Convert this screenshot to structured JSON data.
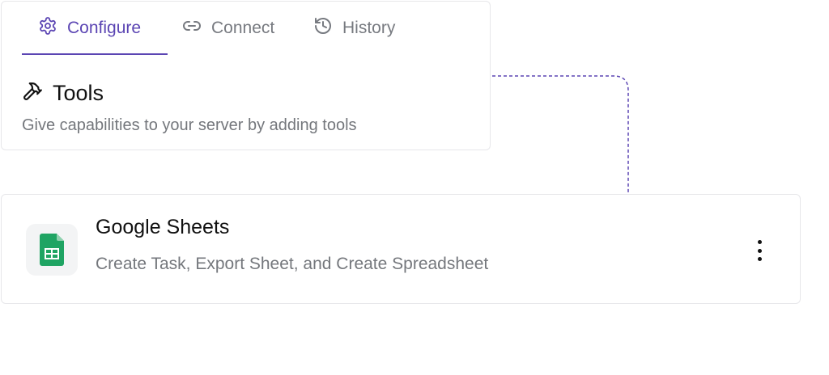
{
  "tabs": [
    {
      "label": "Configure",
      "icon": "gear-icon",
      "active": true
    },
    {
      "label": "Connect",
      "icon": "link-icon",
      "active": false
    },
    {
      "label": "History",
      "icon": "history-icon",
      "active": false
    }
  ],
  "tools": {
    "icon": "hammer-icon",
    "title": "Tools",
    "subtitle": "Give capabilities to your server by adding tools"
  },
  "tool_item": {
    "icon": "google-sheets-icon",
    "name": "Google Sheets",
    "description": "Create Task, Export Sheet, and Create Spreadsheet",
    "menu_icon": "more-vertical-icon"
  },
  "colors": {
    "accent": "#5b45b3",
    "muted_text": "#74777c",
    "border": "#e7e7ea",
    "sheets_green": "#1fa463"
  }
}
